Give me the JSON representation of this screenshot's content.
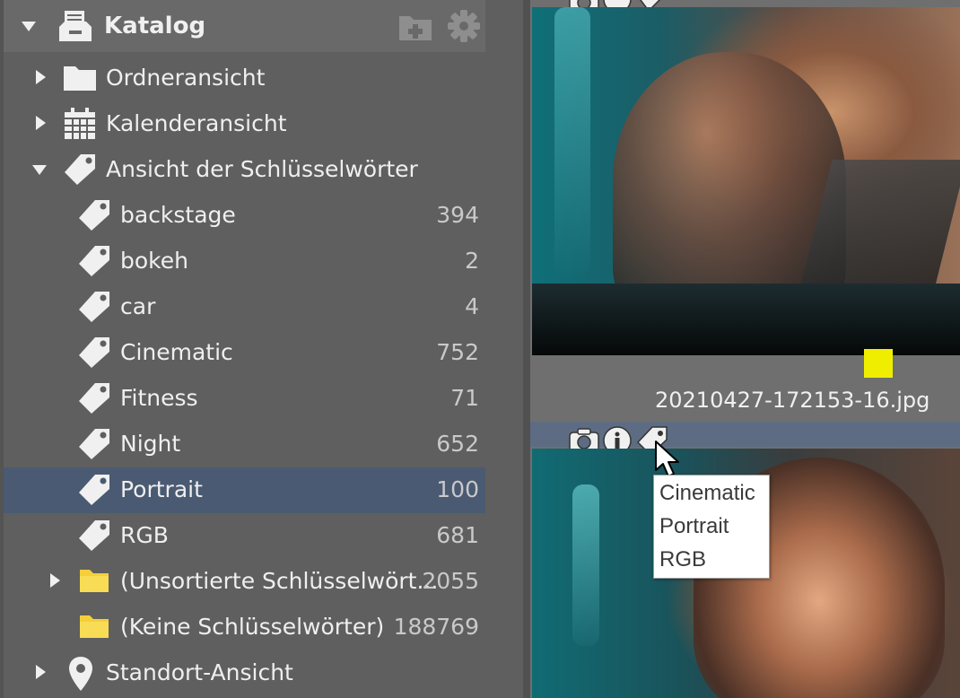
{
  "catalog": {
    "title": "Katalog",
    "header_icons": [
      "catalog-icon",
      "new-folder-icon",
      "gear-icon"
    ]
  },
  "tree": {
    "folder_view": "Ordneransicht",
    "calendar_view": "Kalenderansicht",
    "keyword_view": "Ansicht der Schlüsselwörter",
    "location_view": "Standort-Ansicht"
  },
  "keywords": [
    {
      "label": "backstage",
      "count": "394"
    },
    {
      "label": "bokeh",
      "count": "2"
    },
    {
      "label": "car",
      "count": "4"
    },
    {
      "label": "Cinematic",
      "count": "752"
    },
    {
      "label": "Fitness",
      "count": "71"
    },
    {
      "label": "Night",
      "count": "652"
    },
    {
      "label": "Portrait",
      "count": "100"
    },
    {
      "label": "RGB",
      "count": "681"
    }
  ],
  "unsorted": {
    "label": "(Unsortierte Schlüsselwört...",
    "count": "2055"
  },
  "no_keywords": {
    "label": "(Keine Schlüsselwörter)",
    "count": "188769"
  },
  "selected_keyword": "Portrait",
  "photo1": {
    "filename": "20210427-172153-16.jpg",
    "color_label": "#f0ee00"
  },
  "photo_icons": [
    "camera-icon",
    "info-icon",
    "tag-icon"
  ],
  "tooltip": {
    "line1": "Cinematic",
    "line2": "Portrait",
    "line3": "RGB"
  },
  "colors": {
    "selection": "#4a5a72",
    "panel": "#5f5f5f",
    "accent_yellow": "#f0ee00"
  }
}
